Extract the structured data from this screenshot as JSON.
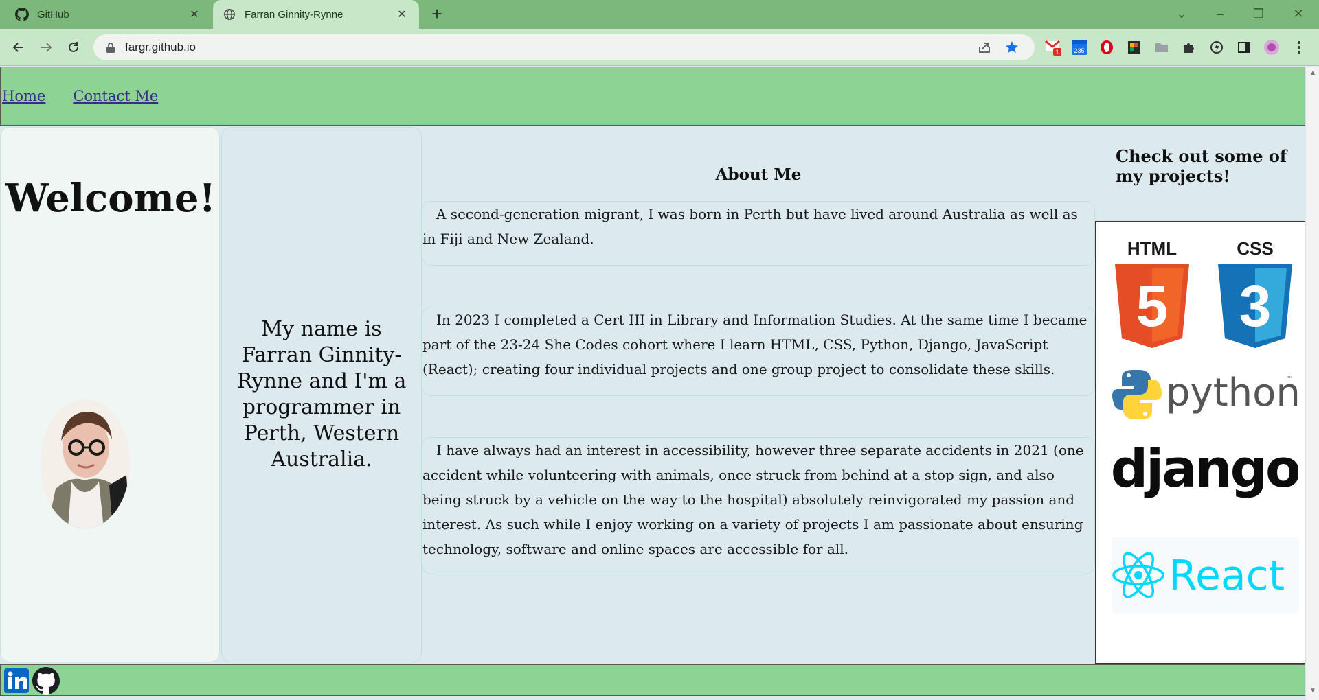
{
  "browser": {
    "tabs": [
      {
        "label": "GitHub",
        "icon": "github-icon"
      },
      {
        "label": "Farran Ginnity-Rynne",
        "icon": "globe-icon"
      }
    ],
    "address": "fargr.github.io",
    "extensions": {
      "gmail_badge": "1",
      "calendar_badge": "235"
    }
  },
  "site": {
    "nav": [
      "Home",
      "Contact Me"
    ],
    "welcome": "Welcome!",
    "intro": "My name is Farran Ginnity-Rynne and I'm a programmer in Perth, Western Australia.",
    "about_title": "About Me",
    "about": [
      "A second-generation migrant, I was born in Perth but have lived around Australia as well as in Fiji and New Zealand.",
      "In 2023 I completed a Cert III in Library and Information Studies. At the same time I became part of the 23-24 She Codes cohort where I learn HTML, CSS, Python, Django, JavaScript (React); creating four individual projects and one group project to consolidate these skills.",
      "I have always had an interest in accessibility, however three separate accidents in 2021 (one accident while volunteering with animals, once struck from behind at a stop sign, and also being struck by a vehicle on the way to the hospital) absolutely reinvigorated my passion and interest. As such while I enjoy working on a variety of projects I am passionate about ensuring technology, software and online spaces are accessible for all."
    ],
    "projects_title": "Check out some of my projects!",
    "logos": {
      "html": "HTML",
      "html_num": "5",
      "css": "CSS",
      "css_num": "3",
      "python": "python",
      "python_tm": "™",
      "django": "django",
      "react": "React"
    },
    "footer_icons": [
      "linkedin-icon",
      "github-icon"
    ]
  },
  "colors": {
    "nav_bg": "#8dd494",
    "page_bg": "#dceaf0",
    "link": "#3a2d8a",
    "html_orange": "#e44d26",
    "css_blue": "#2965f1",
    "react_cyan": "#00d8ff"
  }
}
